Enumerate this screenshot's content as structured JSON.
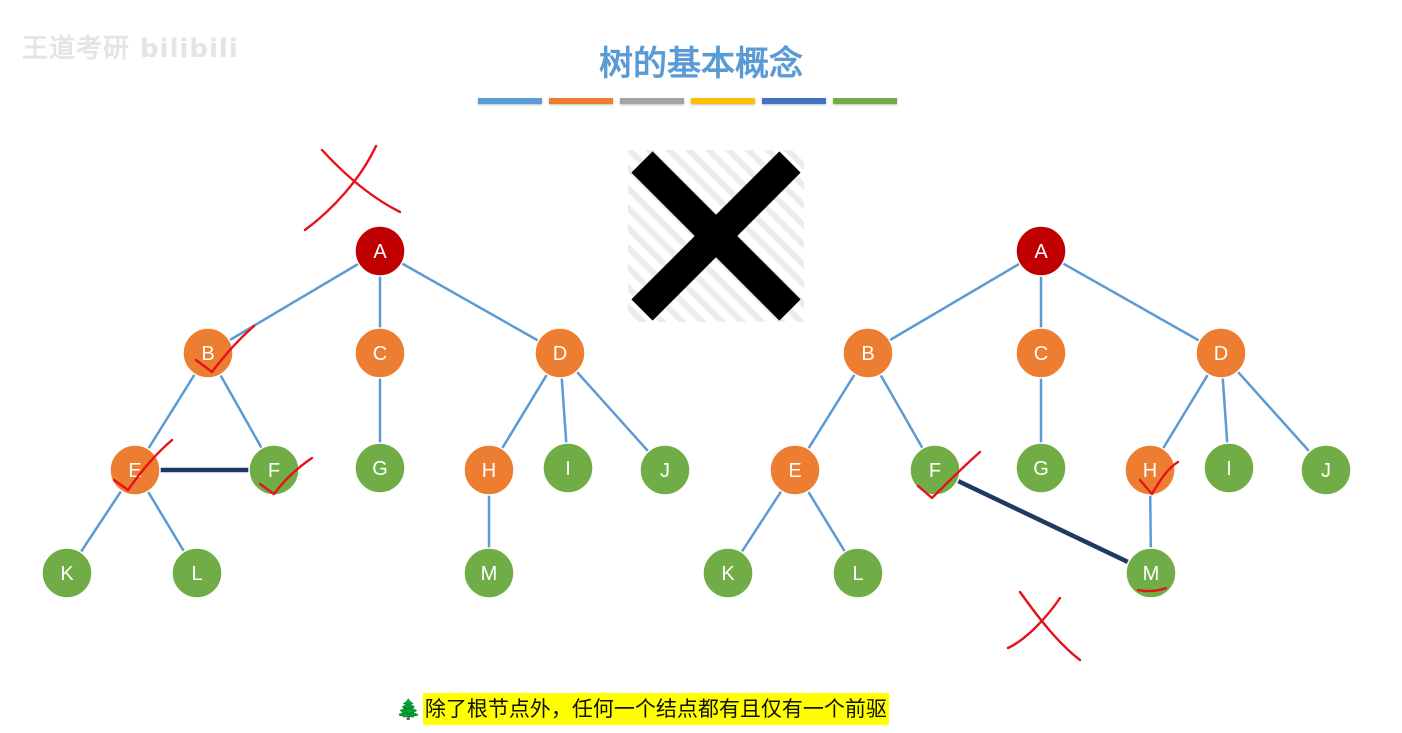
{
  "watermark": "王道考研 bilibili",
  "title": "树的基本概念",
  "color_bars": [
    "#5b9bd5",
    "#ed7d31",
    "#a5a5a5",
    "#ffc000",
    "#4472c4",
    "#70ad47"
  ],
  "node_colors": {
    "root": "#c00000",
    "internal": "#ed7d31",
    "leaf": "#70ad47",
    "edge": "#5b9bd5",
    "extra_edge": "#1f3864",
    "mark": "#e8101a"
  },
  "trees": [
    {
      "name": "left",
      "nodes": [
        {
          "id": "A",
          "label": "A",
          "kind": "root"
        },
        {
          "id": "B",
          "label": "B",
          "kind": "internal"
        },
        {
          "id": "C",
          "label": "C",
          "kind": "internal"
        },
        {
          "id": "D",
          "label": "D",
          "kind": "internal"
        },
        {
          "id": "E",
          "label": "E",
          "kind": "internal"
        },
        {
          "id": "F",
          "label": "F",
          "kind": "leaf"
        },
        {
          "id": "G",
          "label": "G",
          "kind": "leaf"
        },
        {
          "id": "H",
          "label": "H",
          "kind": "internal"
        },
        {
          "id": "I",
          "label": "I",
          "kind": "leaf"
        },
        {
          "id": "J",
          "label": "J",
          "kind": "leaf"
        },
        {
          "id": "K",
          "label": "K",
          "kind": "leaf"
        },
        {
          "id": "L",
          "label": "L",
          "kind": "leaf"
        },
        {
          "id": "M",
          "label": "M",
          "kind": "leaf"
        }
      ],
      "edges": [
        [
          "A",
          "B"
        ],
        [
          "A",
          "C"
        ],
        [
          "A",
          "D"
        ],
        [
          "B",
          "E"
        ],
        [
          "B",
          "F"
        ],
        [
          "C",
          "G"
        ],
        [
          "D",
          "H"
        ],
        [
          "D",
          "I"
        ],
        [
          "D",
          "J"
        ],
        [
          "E",
          "K"
        ],
        [
          "E",
          "L"
        ],
        [
          "H",
          "M"
        ]
      ],
      "extra_edges": [
        [
          "E",
          "F"
        ]
      ]
    },
    {
      "name": "right",
      "nodes": [
        {
          "id": "A",
          "label": "A",
          "kind": "root"
        },
        {
          "id": "B",
          "label": "B",
          "kind": "internal"
        },
        {
          "id": "C",
          "label": "C",
          "kind": "internal"
        },
        {
          "id": "D",
          "label": "D",
          "kind": "internal"
        },
        {
          "id": "E",
          "label": "E",
          "kind": "internal"
        },
        {
          "id": "F",
          "label": "F",
          "kind": "leaf"
        },
        {
          "id": "G",
          "label": "G",
          "kind": "leaf"
        },
        {
          "id": "H",
          "label": "H",
          "kind": "internal"
        },
        {
          "id": "I",
          "label": "I",
          "kind": "leaf"
        },
        {
          "id": "J",
          "label": "J",
          "kind": "leaf"
        },
        {
          "id": "K",
          "label": "K",
          "kind": "leaf"
        },
        {
          "id": "L",
          "label": "L",
          "kind": "leaf"
        },
        {
          "id": "M",
          "label": "M",
          "kind": "leaf"
        }
      ],
      "edges": [
        [
          "A",
          "B"
        ],
        [
          "A",
          "C"
        ],
        [
          "A",
          "D"
        ],
        [
          "B",
          "E"
        ],
        [
          "B",
          "F"
        ],
        [
          "C",
          "G"
        ],
        [
          "D",
          "H"
        ],
        [
          "D",
          "I"
        ],
        [
          "D",
          "J"
        ],
        [
          "E",
          "K"
        ],
        [
          "E",
          "L"
        ],
        [
          "H",
          "M"
        ]
      ],
      "extra_edges": [
        [
          "F",
          "M"
        ]
      ]
    }
  ],
  "caption": "除了根节点外，任何一个结点都有且仅有一个前驱"
}
